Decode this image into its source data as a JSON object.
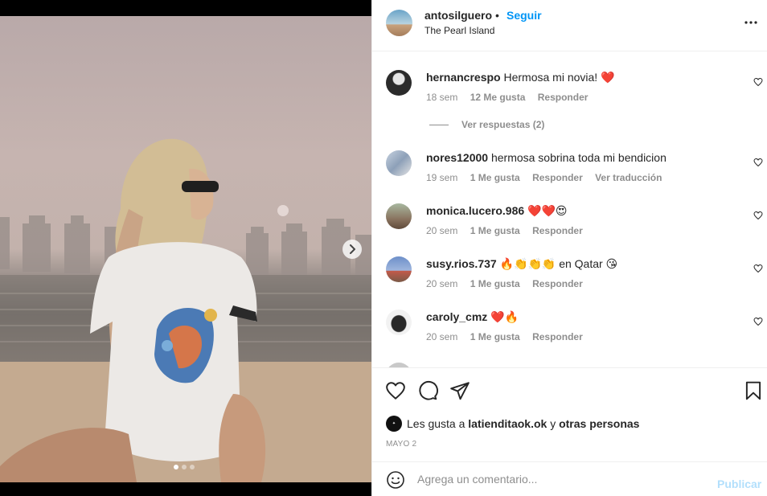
{
  "post": {
    "author": "antosilguero",
    "separator": "•",
    "follow_label": "Seguir",
    "location": "The Pearl Island",
    "carousel_count": 3,
    "carousel_active": 1
  },
  "comments": [
    {
      "user": "hernancrespo",
      "text": "Hermosa mi novia! ❤️",
      "time": "18 sem",
      "likes": "12 Me gusta",
      "reply": "Responder",
      "view_replies": "Ver respuestas (2)"
    },
    {
      "user": "nores12000",
      "text": "hermosa sobrina toda mi bendicion",
      "time": "19 sem",
      "likes": "1 Me gusta",
      "reply": "Responder",
      "translate": "Ver traducción"
    },
    {
      "user": "monica.lucero.986",
      "text": "❤️❤️😍",
      "time": "20 sem",
      "likes": "1 Me gusta",
      "reply": "Responder"
    },
    {
      "user": "susy.rios.737",
      "text": "🔥👏👏👏 en Qatar 😘",
      "time": "20 sem",
      "likes": "1 Me gusta",
      "reply": "Responder"
    },
    {
      "user": "caroly_cmz",
      "text": "❤️🔥",
      "time": "20 sem",
      "likes": "1 Me gusta",
      "reply": "Responder"
    }
  ],
  "likes": {
    "prefix": "Les gusta a",
    "user": "latienditaok.ok",
    "middle": "y",
    "others": "otras personas"
  },
  "date": "MAYO 2",
  "add_comment": {
    "placeholder": "Agrega un comentario...",
    "post_label": "Publicar"
  },
  "colors": {
    "accent": "#0095f6",
    "muted": "#8e8e8e",
    "text": "#262626",
    "post_disabled": "#b2dffc"
  }
}
